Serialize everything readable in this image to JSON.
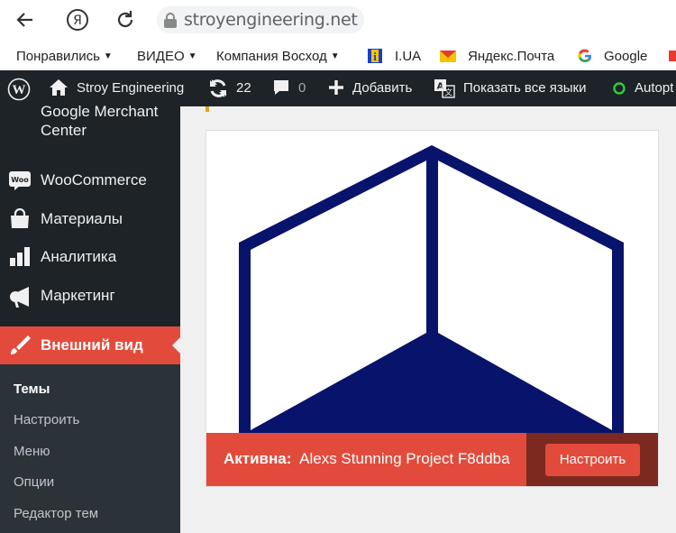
{
  "browser": {
    "url": "stroyengineering.net"
  },
  "bookmarks": [
    {
      "label": "Понравились",
      "dropdown": true
    },
    {
      "label": "ВИДЕО",
      "dropdown": true
    },
    {
      "label": "Компания Восход",
      "dropdown": true
    },
    {
      "label": "I.UA",
      "icon": "iua-icon"
    },
    {
      "label": "Яндекс.Почта",
      "icon": "mail-icon"
    },
    {
      "label": "Google",
      "icon": "google-icon"
    }
  ],
  "adminbar": {
    "site_name": "Stroy Engineering",
    "updates_count": "22",
    "comments_count": "0",
    "add_new": "Добавить",
    "show_all_languages": "Показать все языки",
    "autoptimize": "Autopt"
  },
  "sidebar": {
    "items": [
      {
        "label": "Google Merchant Center"
      },
      {
        "label": "WooCommerce"
      },
      {
        "label": "Материалы"
      },
      {
        "label": "Аналитика"
      },
      {
        "label": "Маркетинг"
      },
      {
        "label": "Внешний вид",
        "active": true
      }
    ],
    "submenu": [
      {
        "label": "Темы",
        "current": true
      },
      {
        "label": "Настроить"
      },
      {
        "label": "Меню"
      },
      {
        "label": "Опции"
      },
      {
        "label": "Редактор тем"
      }
    ]
  },
  "theme": {
    "active_prefix": "Активна:",
    "name": "Alexs Stunning Project F8ddba",
    "customize_label": "Настроить"
  },
  "colors": {
    "accent": "#e24b3b",
    "adminbar": "#1d2327",
    "logo_blue": "#08136b"
  }
}
